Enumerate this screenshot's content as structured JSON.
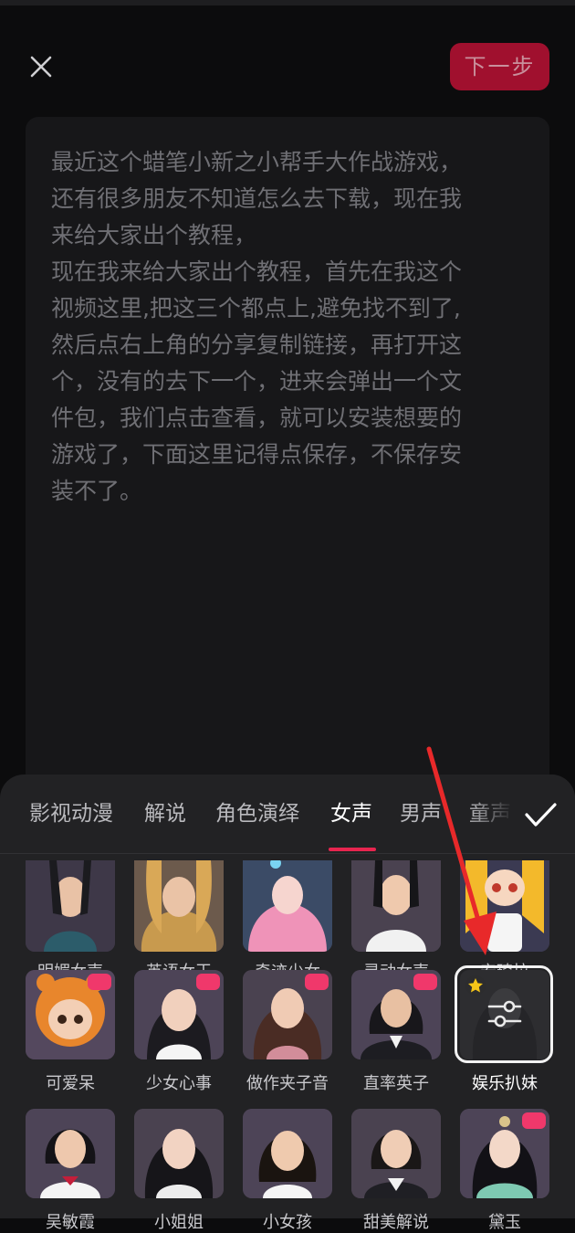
{
  "header": {
    "next_label": "下一步"
  },
  "script": {
    "text": "最近这个蜡笔小新之小帮手大作战游戏，\n还有很多朋友不知道怎么去下载，现在我\n来给大家出个教程，\n现在我来给大家出个教程，首先在我这个\n视频这里,把这三个都点上,避免找不到了,\n然后点右上角的分享复制链接，再打开这\n个，没有的去下一个，进来会弹出一个文\n件包，我们点击查看，就可以安装想要的\n游戏了，下面这里记得点保存，不保存安\n装不了。"
  },
  "voice_panel": {
    "tabs": [
      "影视动漫",
      "解说",
      "角色演绎",
      "女声",
      "男声",
      "童声"
    ],
    "active_tab": "女声",
    "row1": [
      "明媚女声",
      "英语女王",
      "奇迹少女",
      "灵动女声",
      "安琦拉"
    ],
    "row2": [
      "可爱呆",
      "少女心事",
      "做作夹子音",
      "直率英子",
      "娱乐扒妹"
    ],
    "row3": [
      "吴敏霞",
      "小姐姐",
      "小女孩",
      "甜美解说",
      "黛玉"
    ],
    "selected": "娱乐扒妹"
  },
  "colors": {
    "accent": "#e8254f",
    "next_button": "#a0102e"
  }
}
